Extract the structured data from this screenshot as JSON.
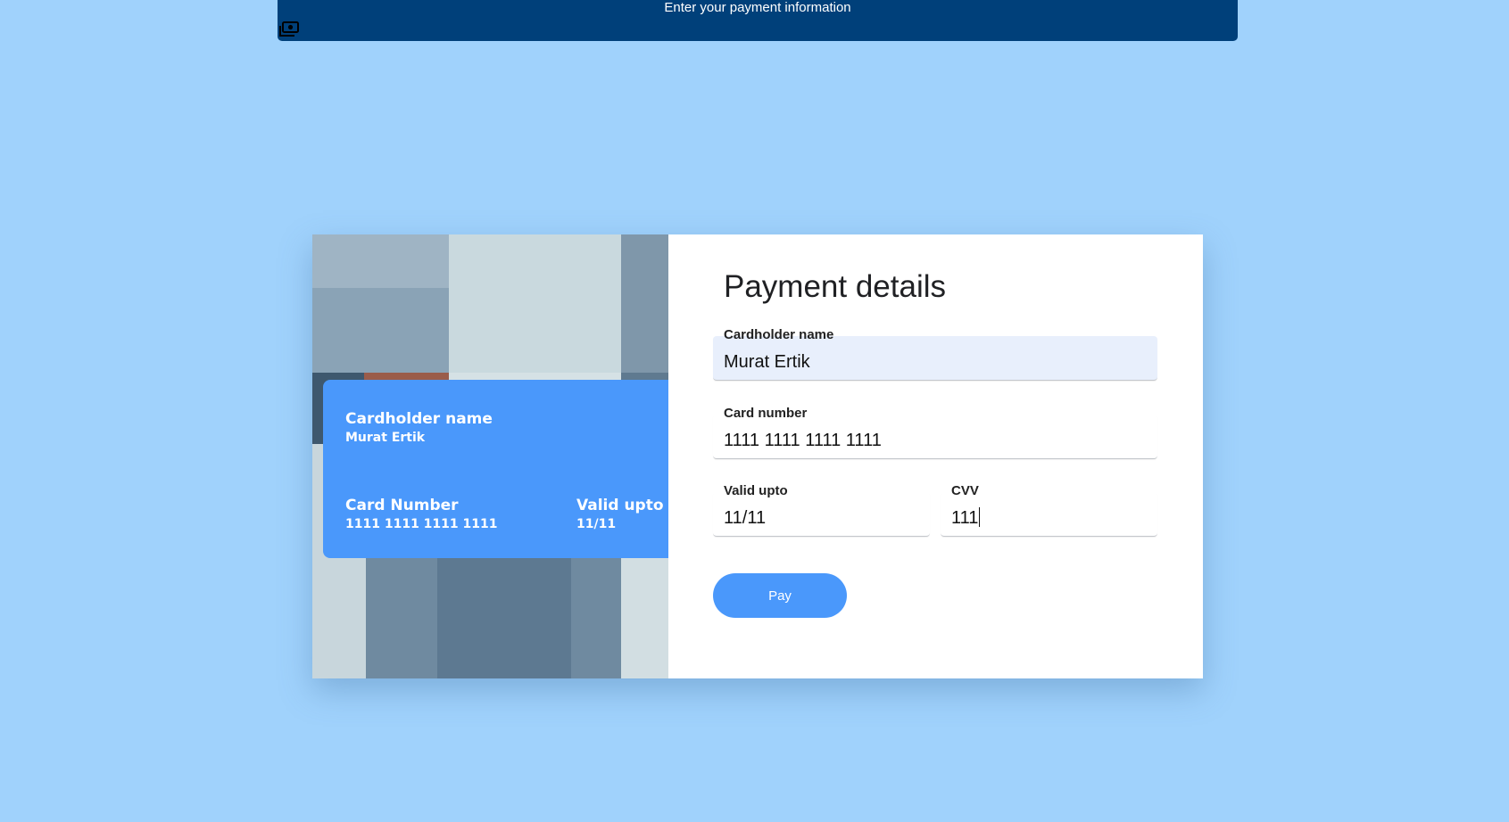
{
  "banner": {
    "title": "Enter your payment information",
    "icon": "money-icon"
  },
  "card_preview": {
    "cardholder_label": "Cardholder name",
    "cardholder_value": "Murat Ertik",
    "number_label": "Card Number",
    "number_value": "1111 1111 1111 1111",
    "valid_label": "Valid upto",
    "valid_value": "11/11",
    "color": "#4a98fb"
  },
  "form": {
    "title": "Payment details",
    "cardholder": {
      "label": "Cardholder name",
      "value": "Murat Ertik"
    },
    "card_number": {
      "label": "Card number",
      "value": "1111 1111 1111 1111"
    },
    "valid_upto": {
      "label": "Valid upto",
      "value": "11/11"
    },
    "cvv": {
      "label": "CVV",
      "value": "111"
    },
    "pay_label": "Pay"
  },
  "colors": {
    "page_background": "#a0d2fc",
    "banner_background": "#00407a",
    "accent": "#4a98fb",
    "autofill_background": "#e8effc"
  }
}
